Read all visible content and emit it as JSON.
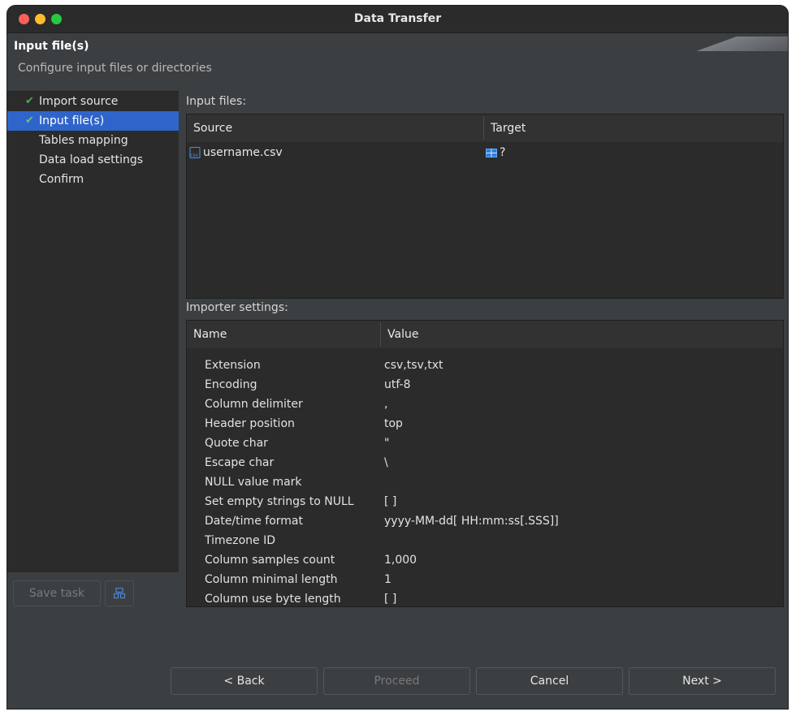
{
  "window": {
    "title": "Data Transfer"
  },
  "header": {
    "page_title": "Input file(s)",
    "description": "Configure input files or directories"
  },
  "nav": {
    "items": [
      {
        "label": "Import source",
        "done": true,
        "selected": false
      },
      {
        "label": "Input file(s)",
        "done": true,
        "selected": true
      },
      {
        "label": "Tables mapping",
        "done": false,
        "selected": false
      },
      {
        "label": "Data load settings",
        "done": false,
        "selected": false
      },
      {
        "label": "Confirm",
        "done": false,
        "selected": false
      }
    ],
    "save_task_label": "Save task"
  },
  "input_files": {
    "section_label": "Input files:",
    "columns": [
      "Source",
      "Target"
    ],
    "rows": [
      {
        "source": "username.csv",
        "target": "?"
      }
    ]
  },
  "importer_settings": {
    "section_label": "Importer settings:",
    "columns": [
      "Name",
      "Value"
    ],
    "rows": [
      {
        "name": "Extension",
        "value": "csv,tsv,txt"
      },
      {
        "name": "Encoding",
        "value": "utf-8"
      },
      {
        "name": "Column delimiter",
        "value": ","
      },
      {
        "name": "Header position",
        "value": "top"
      },
      {
        "name": "Quote char",
        "value": "\""
      },
      {
        "name": "Escape char",
        "value": "\\"
      },
      {
        "name": "NULL value mark",
        "value": ""
      },
      {
        "name": "Set empty strings to NULL",
        "value": "[ ]"
      },
      {
        "name": "Date/time format",
        "value": "yyyy-MM-dd[ HH:mm:ss[.SSS]]"
      },
      {
        "name": "Timezone ID",
        "value": ""
      },
      {
        "name": "Column samples count",
        "value": "1,000"
      },
      {
        "name": "Column minimal length",
        "value": "1"
      },
      {
        "name": "Column use byte length",
        "value": "[ ]"
      }
    ]
  },
  "footer": {
    "back_label": "< Back",
    "proceed_label": "Proceed",
    "cancel_label": "Cancel",
    "next_label": "Next >"
  },
  "colors": {
    "selection": "#2f65ca",
    "check": "#4cae4c",
    "window_bg": "#3c3f41",
    "panel_bg": "#2b2b2b"
  }
}
